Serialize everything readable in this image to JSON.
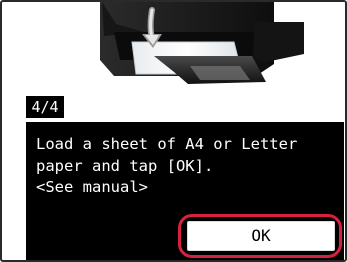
{
  "step_indicator": "4/4",
  "message": {
    "line1": "Load a sheet of A4 or Letter",
    "line2": "paper and tap [OK].",
    "line3": "<See manual>"
  },
  "buttons": {
    "ok_label": "OK"
  },
  "colors": {
    "panel_background": "#000000",
    "panel_text": "#ffffff",
    "highlight": "#d6213f"
  },
  "illustration": {
    "icon": "printer-paper-load-illustration"
  }
}
